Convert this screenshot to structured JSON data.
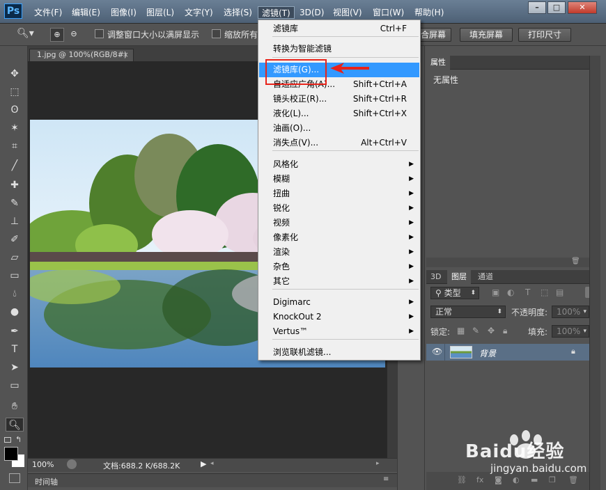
{
  "app": {
    "logo": "Ps"
  },
  "menubar": {
    "items": [
      "文件(F)",
      "编辑(E)",
      "图像(I)",
      "图层(L)",
      "文字(Y)",
      "选择(S)",
      "滤镜(T)",
      "3D(D)",
      "视图(V)",
      "窗口(W)",
      "帮助(H)"
    ],
    "active_index": 6
  },
  "window_controls": {
    "minimize": "–",
    "maximize": "□",
    "close": "✕"
  },
  "options": {
    "resize_windows": "调整窗口大小以满屏显示",
    "zoom_all": "缩放所有",
    "fit_screen": "合屏幕",
    "fill_screen": "填充屏幕",
    "print_size": "打印尺寸"
  },
  "document": {
    "tab_title": "1.jpg @ 100%(RGB/8#)",
    "zoom": "100%",
    "doc_size": "文档:688.2 K/688.2K",
    "timeline": "时间轴"
  },
  "filter_menu": {
    "items": [
      {
        "label": "滤镜库",
        "shortcut": "Ctrl+F"
      },
      {
        "label": "转换为智能滤镜"
      },
      {
        "label": "滤镜库(G)...",
        "hover": true
      },
      {
        "label": "自适应广角(A)...",
        "shortcut": "Shift+Ctrl+A"
      },
      {
        "label": "镜头校正(R)...",
        "shortcut": "Shift+Ctrl+R"
      },
      {
        "label": "液化(L)...",
        "shortcut": "Shift+Ctrl+X"
      },
      {
        "label": "油画(O)..."
      },
      {
        "label": "消失点(V)...",
        "shortcut": "Alt+Ctrl+V"
      },
      {
        "label": "风格化",
        "submenu": true
      },
      {
        "label": "模糊",
        "submenu": true
      },
      {
        "label": "扭曲",
        "submenu": true
      },
      {
        "label": "锐化",
        "submenu": true
      },
      {
        "label": "视频",
        "submenu": true
      },
      {
        "label": "像素化",
        "submenu": true
      },
      {
        "label": "渲染",
        "submenu": true
      },
      {
        "label": "杂色",
        "submenu": true
      },
      {
        "label": "其它",
        "submenu": true
      },
      {
        "label": "Digimarc",
        "submenu": true
      },
      {
        "label": "KnockOut 2",
        "submenu": true
      },
      {
        "label": "Vertus™",
        "submenu": true
      },
      {
        "label": "浏览联机滤镜..."
      }
    ]
  },
  "properties_panel": {
    "tab": "属性",
    "empty_text": "无属性"
  },
  "layers_panel": {
    "tabs": [
      "3D",
      "图层",
      "通道"
    ],
    "active_tab_index": 1,
    "filter_kind": "类型",
    "blend_mode": "正常",
    "opacity_label": "不透明度:",
    "opacity_value": "100%",
    "lock_label": "锁定:",
    "fill_label": "填充:",
    "fill_value": "100%",
    "layers": [
      {
        "name": "背景",
        "locked": true,
        "visible": true
      }
    ]
  },
  "watermark": {
    "brand": "Baidu经验",
    "url": "jingyan.baidu.com"
  },
  "colors": {
    "menu_hover": "#3399ff",
    "annotation_red": "#e8231a",
    "layer_selected": "#5a6f86"
  }
}
